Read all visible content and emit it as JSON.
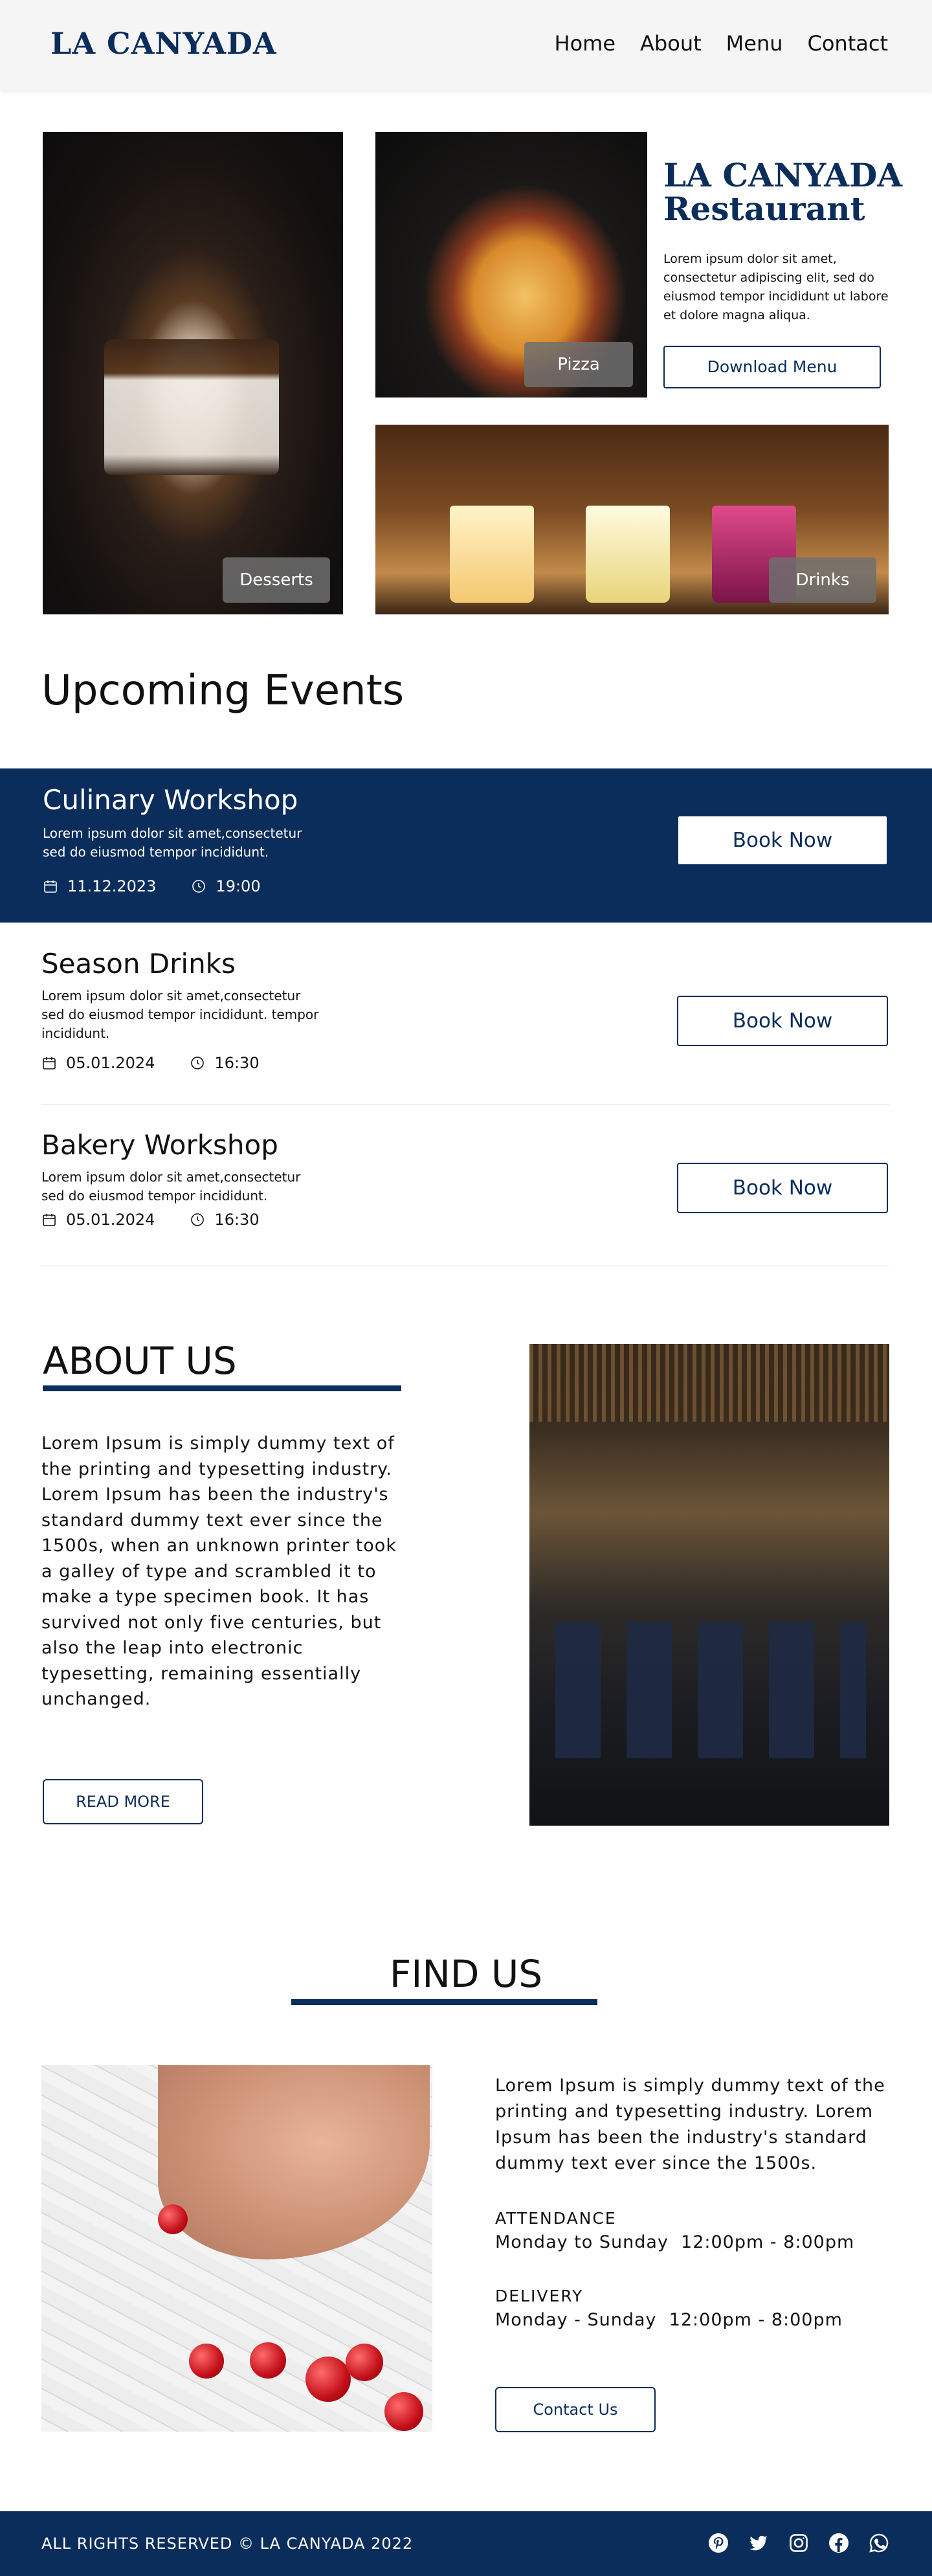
{
  "header": {
    "logo": "LA CANYADA",
    "nav": [
      "Home",
      "About",
      "Menu",
      "Contact"
    ]
  },
  "hero": {
    "chips": {
      "desserts": "Desserts",
      "pizza": "Pizza",
      "drinks": "Drinks"
    },
    "title": "LA CANYADA Restaurant",
    "text": "Lorem ipsum dolor sit amet, consectetur adipiscing elit, sed do eiusmod tempor incididunt ut labore et dolore magna aliqua.",
    "download_label": "Download Menu"
  },
  "events": {
    "heading": "Upcoming Events",
    "book_label": "Book Now",
    "items": [
      {
        "title": "Culinary Workshop",
        "desc": "Lorem ipsum dolor sit amet,consectetur sed do eiusmod tempor incididunt.",
        "date": "11.12.2023",
        "time": "19:00"
      },
      {
        "title": "Season Drinks",
        "desc": "Lorem ipsum dolor sit amet,consectetur sed do eiusmod tempor incididunt. tempor incididunt.",
        "date": "05.01.2024",
        "time": "16:30"
      },
      {
        "title": "Bakery Workshop",
        "desc": "Lorem ipsum dolor sit amet,consectetur sed do eiusmod tempor incididunt.",
        "date": "05.01.2024",
        "time": "16:30"
      }
    ]
  },
  "about": {
    "title": "ABOUT US",
    "text": "Lorem Ipsum is simply dummy text of the printing and typesetting industry. Lorem Ipsum has been the industry's standard dummy text ever since the 1500s, when an unknown printer took a galley of type and scrambled it to make a type specimen book. It has survived not only five centuries, but also the leap into electronic typesetting, remaining essentially unchanged.",
    "button": "READ MORE"
  },
  "find": {
    "title": "FIND US",
    "text": "Lorem Ipsum is simply dummy text of the printing and typesetting industry. Lorem Ipsum has been the industry's standard dummy text ever since the 1500s.",
    "attendance_label": "ATTENDANCE",
    "attendance_hours": "Monday to Sunday  12:00pm - 8:00pm",
    "delivery_label": "DELIVERY",
    "delivery_hours": "Monday - Sunday  12:00pm - 8:00pm",
    "button": "Contact Us"
  },
  "footer": {
    "text": "ALL RIGHTS RESERVED © LA CANYADA 2022",
    "socials": [
      "pinterest-icon",
      "twitter-icon",
      "instagram-icon",
      "facebook-icon",
      "whatsapp-icon"
    ]
  },
  "colors": {
    "brand": "#0b2d5b",
    "header_bg": "#f5f5f5",
    "chip_bg": "#6e6e6e"
  }
}
